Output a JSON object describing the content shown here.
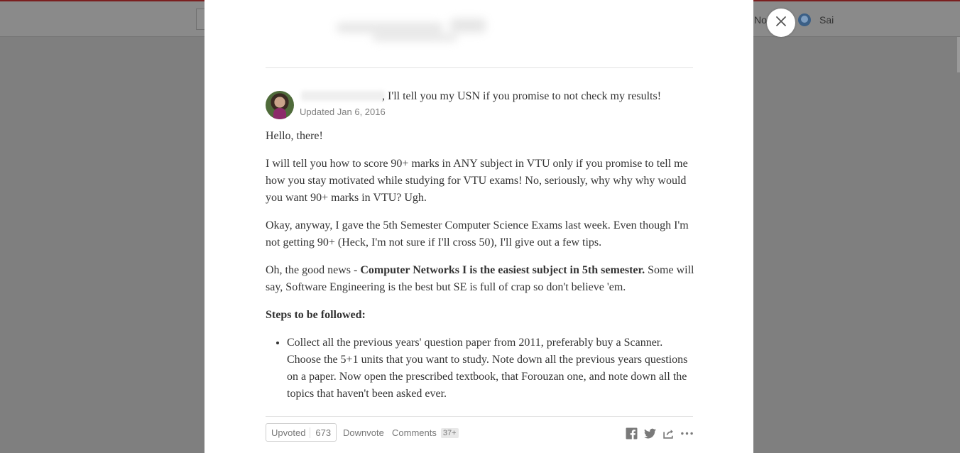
{
  "background_page": {
    "user_name": "Sai",
    "clipped_nav_text": "Notifications"
  },
  "modal": {
    "close_icon": "close-icon",
    "answer": {
      "credential": ", I'll tell you my USN if you promise to not check my results!",
      "updated": "Updated Jan 6, 2016",
      "paragraphs": {
        "p1": "Hello, there!",
        "p2": "I will tell you how to score 90+ marks in ANY subject in VTU only if you promise to tell me how you stay motivated while studying for VTU exams! No, seriously, why why why would you want 90+ marks in VTU? Ugh.",
        "p3": "Okay, anyway, I gave the 5th Semester Computer Science Exams last week. Even though I'm not getting 90+ (Heck, I'm not sure if I'll cross 50), I'll give out a few tips.",
        "p4_prefix": "Oh, the good news - ",
        "p4_bold": "Computer Networks I is the easiest subject in 5th semester.",
        "p4_rest": " Some will say, Software Engineering is the best but SE is full of crap so don't believe 'em.",
        "steps_heading": "Steps to  be followed:",
        "bullet1": "Collect all the previous years' question paper from 2011, preferably buy a Scanner. Choose the 5+1 units that you want to study. Note down all the previous years questions on a paper. Now open the prescribed textbook, that Forouzan one, and note down all the topics that haven't been asked ever."
      }
    },
    "actions": {
      "upvoted_label": "Upvoted",
      "upvote_count": "673",
      "downvote_label": "Downvote",
      "comments_label": "Comments",
      "comments_count": "37+",
      "icons": [
        "facebook-icon",
        "twitter-icon",
        "share-icon",
        "more-icon"
      ]
    }
  },
  "colors": {
    "overlay": "#7f7f7f",
    "text": "#333333",
    "muted": "#777777",
    "brand_top": "#7a1f1f"
  }
}
